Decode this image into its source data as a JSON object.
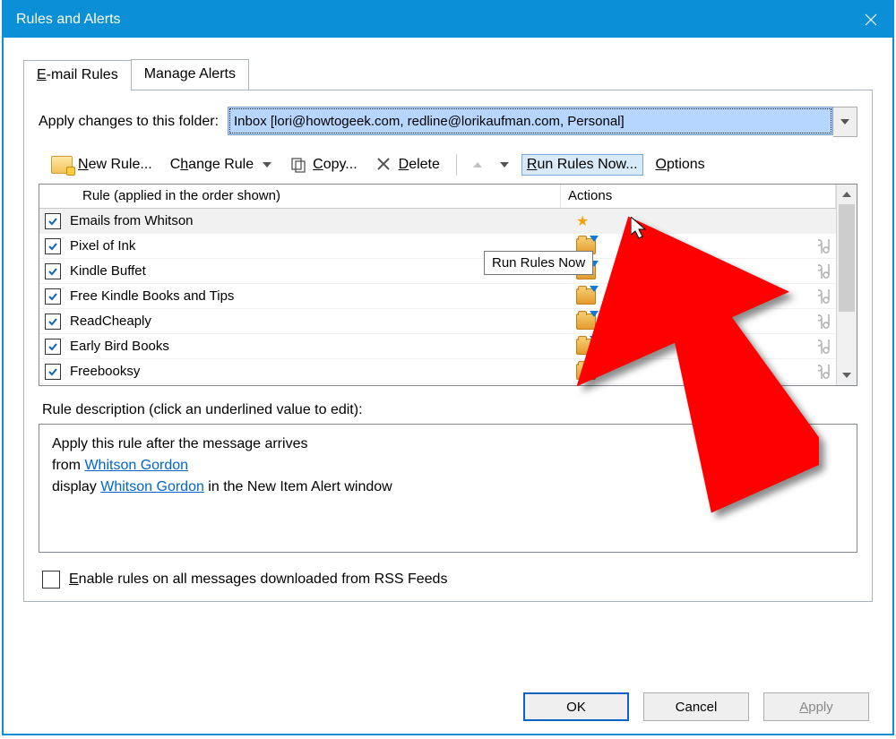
{
  "window": {
    "title": "Rules and Alerts"
  },
  "tabs": {
    "email_rules": "E-mail Rules",
    "manage_alerts": "Manage Alerts"
  },
  "folder": {
    "label": "Apply changes to this folder:",
    "value": "Inbox [lori@howtogeek.com, redline@lorikaufman.com, Personal]"
  },
  "toolbar": {
    "new_rule": "New Rule...",
    "change_rule": "Change Rule",
    "copy": "Copy...",
    "delete": "Delete",
    "run_rules_now": "Run Rules Now...",
    "options": "Options"
  },
  "list": {
    "header_rule": "Rule (applied in the order shown)",
    "header_actions": "Actions",
    "rows": [
      {
        "name": "Emails from Whitson",
        "checked": true,
        "selected": true,
        "star": true,
        "folder": false,
        "tools": false
      },
      {
        "name": "Pixel of Ink",
        "checked": true,
        "selected": false,
        "star": false,
        "folder": true,
        "tools": true
      },
      {
        "name": "Kindle Buffet",
        "checked": true,
        "selected": false,
        "star": false,
        "folder": true,
        "tools": true
      },
      {
        "name": "Free Kindle Books and Tips",
        "checked": true,
        "selected": false,
        "star": false,
        "folder": true,
        "tools": true
      },
      {
        "name": "ReadCheaply",
        "checked": true,
        "selected": false,
        "star": false,
        "folder": true,
        "tools": true
      },
      {
        "name": "Early Bird Books",
        "checked": true,
        "selected": false,
        "star": false,
        "folder": true,
        "tools": true
      },
      {
        "name": "Freebooksy",
        "checked": true,
        "selected": false,
        "star": false,
        "folder": true,
        "tools": true
      }
    ]
  },
  "description": {
    "label": "Rule description (click an underlined value to edit):",
    "line1": "Apply this rule after the message arrives",
    "line2_pre": "from ",
    "line2_link": "Whitson Gordon",
    "line3_pre": "display ",
    "line3_link": "Whitson Gordon",
    "line3_post": " in the New Item Alert window"
  },
  "rss": {
    "label": "Enable rules on all messages downloaded from RSS Feeds"
  },
  "buttons": {
    "ok": "OK",
    "cancel": "Cancel",
    "apply": "Apply"
  },
  "tooltip": "Run Rules Now"
}
